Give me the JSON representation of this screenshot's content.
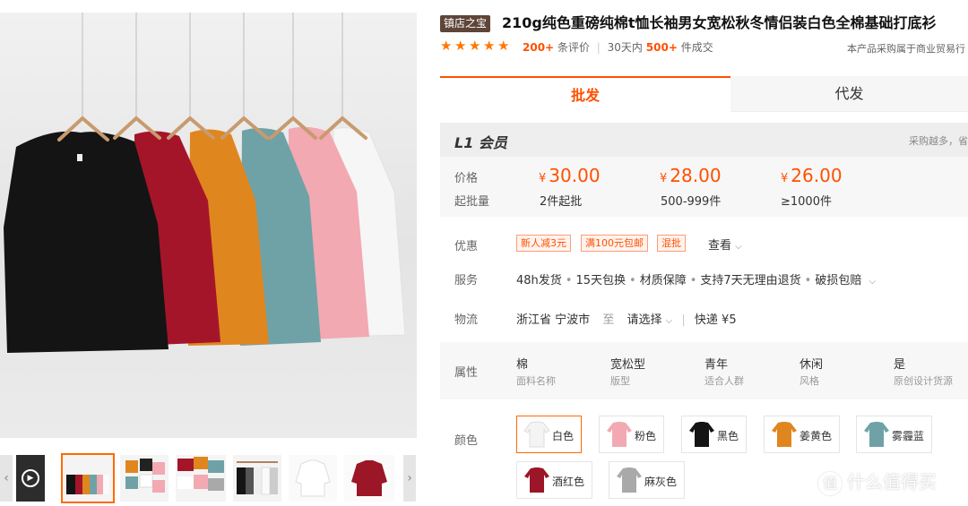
{
  "product": {
    "badge": "镇店之宝",
    "title": "210g纯色重磅纯棉t恤长袖男女宽松秋冬情侣装白色全棉基础打底衫",
    "reviews_count": "200+",
    "reviews_label": "条评价",
    "sales_period": "30天内",
    "sales_count": "500+",
    "sales_label": "件成交",
    "notice": "本产品采购属于商业贸易行",
    "rating": 5
  },
  "tabs": {
    "wholesale": "批发",
    "dropship": "代发"
  },
  "member": {
    "title": "L1 会员",
    "tip": "采购越多，省",
    "price_label": "价格",
    "moq_label": "起批量",
    "currency": "¥",
    "tiers": [
      {
        "price": "30.00",
        "moq": "2件起批"
      },
      {
        "price": "28.00",
        "moq": "500-999件"
      },
      {
        "price": "26.00",
        "moq": "≥1000件"
      }
    ]
  },
  "labels": {
    "discount": "优惠",
    "service": "服务",
    "logistics": "物流",
    "attributes": "属性",
    "color": "颜色"
  },
  "promos": [
    "新人减3元",
    "满100元包邮",
    "混批"
  ],
  "view_more": "查看",
  "services": [
    "48h发货",
    "15天包换",
    "材质保障",
    "支持7天无理由退货",
    "破损包赔"
  ],
  "logistics": {
    "province": "浙江省",
    "city": "宁波市",
    "to": "至",
    "choose": "请选择",
    "method": "快递",
    "fee": "¥5"
  },
  "properties": [
    {
      "value": "棉",
      "key": "面料名称"
    },
    {
      "value": "宽松型",
      "key": "版型"
    },
    {
      "value": "青年",
      "key": "适合人群"
    },
    {
      "value": "休闲",
      "key": "风格"
    },
    {
      "value": "是",
      "key": "原创设计货源"
    }
  ],
  "colors": [
    {
      "name": "白色",
      "hex": "#f4f4f4",
      "selected": true
    },
    {
      "name": "粉色",
      "hex": "#f2a9b2",
      "selected": false
    },
    {
      "name": "黑色",
      "hex": "#141414",
      "selected": false
    },
    {
      "name": "姜黄色",
      "hex": "#e0861e",
      "selected": false
    },
    {
      "name": "雾霾蓝",
      "hex": "#6fa2a6",
      "selected": false
    },
    {
      "name": "酒红色",
      "hex": "#9b1626",
      "selected": false
    },
    {
      "name": "麻灰色",
      "hex": "#a9a9a9",
      "selected": false
    }
  ],
  "photo_shirts": [
    "#141414",
    "#a5152a",
    "#e0861e",
    "#6fa2a6",
    "#f2a9b2",
    "#f6f6f6"
  ],
  "watermark": "什么值得买",
  "watermark_icon": "值",
  "accent": "#ff5000"
}
